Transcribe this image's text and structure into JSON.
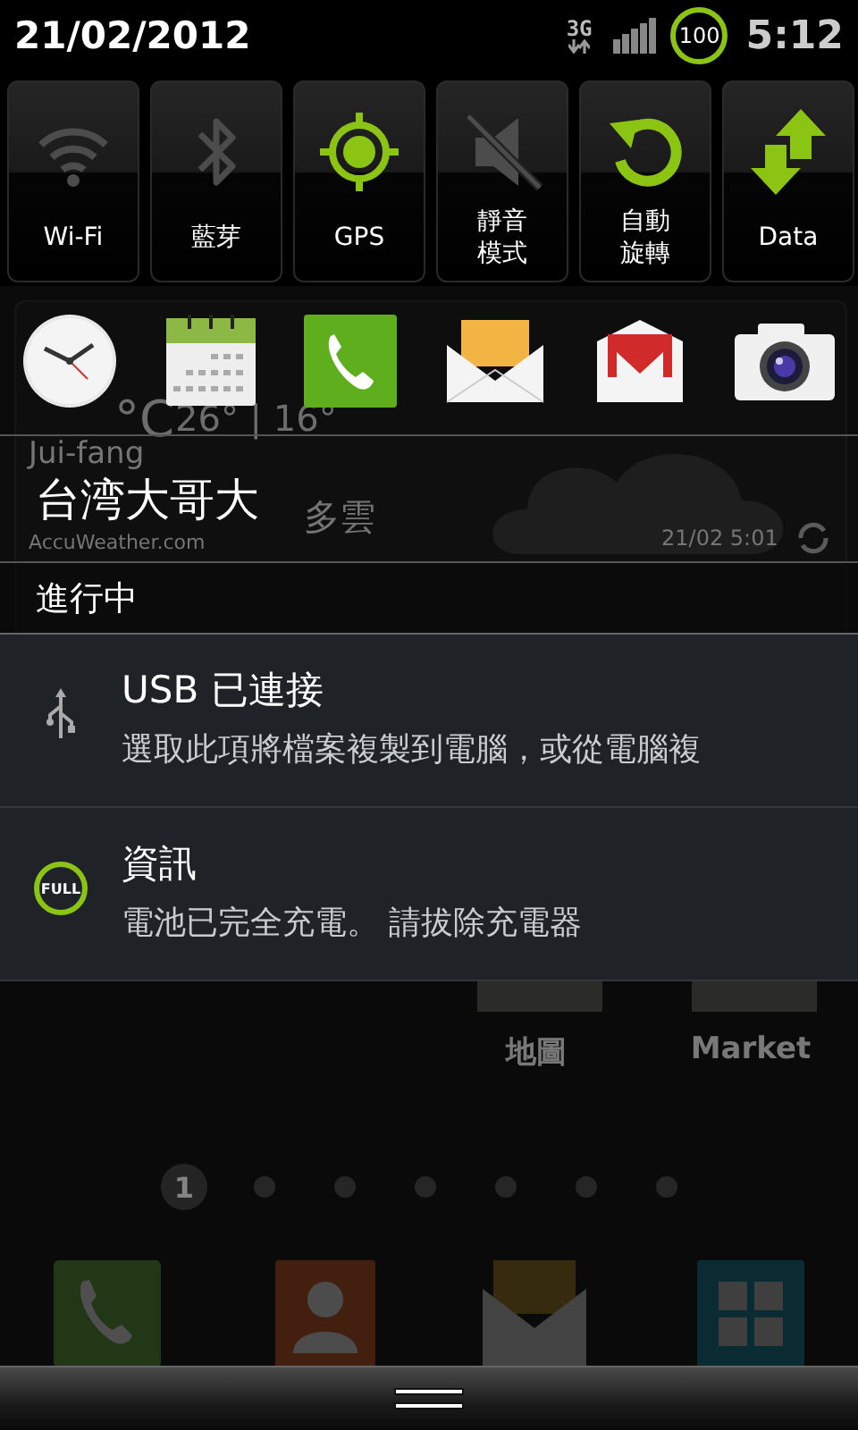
{
  "status_bar": {
    "date": "21/02/2012",
    "network": "3G",
    "battery": "100",
    "time": "5:12"
  },
  "toggles": [
    {
      "kind": "wifi",
      "label": "Wi-Fi",
      "on": false
    },
    {
      "kind": "bluetooth",
      "label": "藍芽",
      "on": false
    },
    {
      "kind": "gps",
      "label": "GPS",
      "on": true
    },
    {
      "kind": "silent",
      "label_lines": [
        "靜音",
        "模式"
      ],
      "on": false
    },
    {
      "kind": "rotation",
      "label_lines": [
        "自動",
        "旋轉"
      ],
      "on": true
    },
    {
      "kind": "data",
      "label": "Data",
      "on": true
    }
  ],
  "shortcuts": [
    {
      "kind": "clock"
    },
    {
      "kind": "calendar"
    },
    {
      "kind": "phone"
    },
    {
      "kind": "email"
    },
    {
      "kind": "gmail"
    },
    {
      "kind": "camera"
    }
  ],
  "carrier": "台湾大哥大",
  "section": "進行中",
  "notifications": [
    {
      "kind": "usb",
      "title": "USB 已連接",
      "text": "選取此項將檔案複製到電腦，或從電腦複"
    },
    {
      "kind": "battery_full",
      "icon_text": "FULL",
      "title": "資訊",
      "text": "電池已完全充電。 請拔除充電器"
    }
  ],
  "background": {
    "weather": {
      "temp_unit": "°C",
      "hi_lo": "26° | 16°",
      "location": "Jui-fang",
      "condition": "多雲",
      "source": "AccuWeather.com",
      "updated": "21/02 5:01"
    },
    "apps": [
      "地圖",
      "Market"
    ],
    "pages": [
      {
        "label": "1",
        "selected": true
      },
      {
        "selected": false
      },
      {
        "selected": false
      },
      {
        "selected": false
      },
      {
        "selected": false
      },
      {
        "selected": false
      },
      {
        "selected": false
      }
    ],
    "dock": [
      {
        "kind": "phone"
      },
      {
        "kind": "contacts"
      },
      {
        "kind": "messaging"
      },
      {
        "kind": "apps"
      }
    ]
  }
}
